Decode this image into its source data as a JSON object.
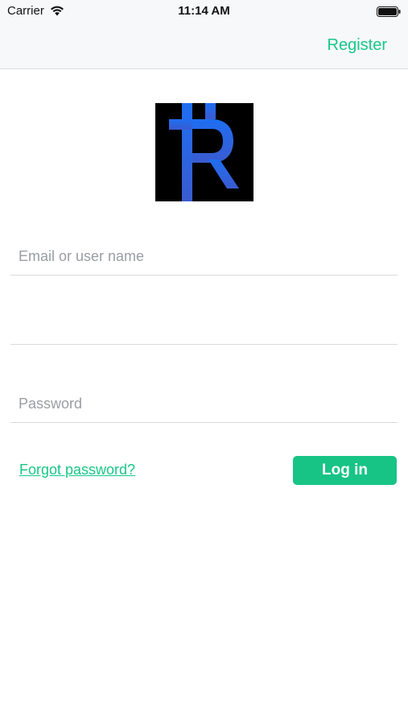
{
  "status_bar": {
    "carrier": "Carrier",
    "time": "11:14 AM",
    "wifi_icon": "wifi-icon",
    "battery_icon": "battery-full-icon"
  },
  "nav": {
    "register_label": "Register"
  },
  "logo": {
    "icon": "app-logo-r-icon",
    "background_color": "#000000",
    "gradient_top": "#1e6ef2",
    "gradient_bottom": "#3a5bd0"
  },
  "login_form": {
    "email_placeholder": "Email or user name",
    "email_value": "",
    "middle_field_value": "",
    "password_placeholder": "Password",
    "password_value": "",
    "forgot_password_label": "Forgot password?",
    "login_button_label": "Log in"
  },
  "colors": {
    "accent": "#19c789",
    "button_bg": "#18c485",
    "divider": "#d9dadd",
    "placeholder": "#9a9da2"
  }
}
